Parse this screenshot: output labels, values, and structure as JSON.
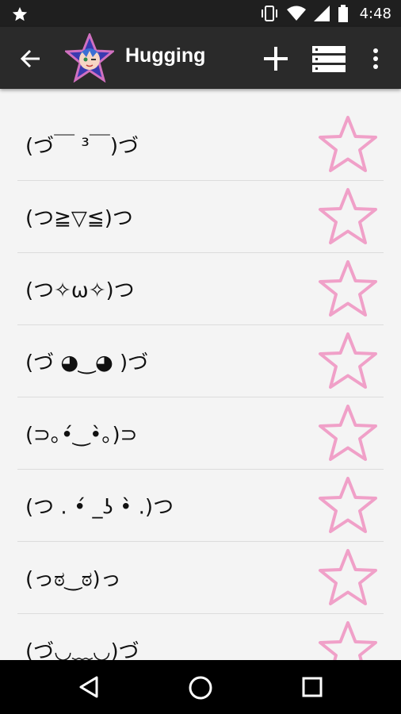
{
  "status": {
    "time": "4:48"
  },
  "toolbar": {
    "title": "Hugging"
  },
  "colors": {
    "accent_star": "#f0a0c8",
    "app_bar": "#2a2a2a"
  },
  "icons": {
    "back": "arrow-left-icon",
    "add": "plus-icon",
    "list": "list-view-icon",
    "more": "more-vert-icon",
    "favorite": "star-outline-icon"
  },
  "emoticons": [
    "(づ￣ ³￣)づ",
    "(つ≧▽≦)つ",
    "(つ✧ω✧)つ",
    "(づ ◕‿◕ )づ",
    "(⊃｡•́‿•̀｡)⊃",
    "(つ . •́ _ʖ •̀ .)つ",
    "(っಠ‿ಠ)っ",
    "(づ◡﹏◡)づ"
  ]
}
